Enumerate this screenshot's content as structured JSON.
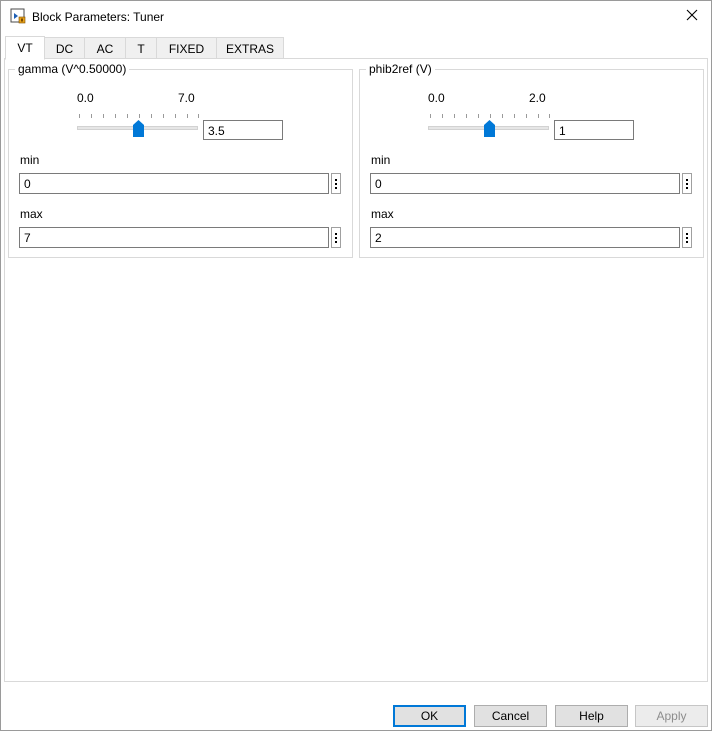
{
  "window": {
    "title": "Block Parameters: Tuner"
  },
  "tabs": [
    {
      "label": "VT",
      "active": true
    },
    {
      "label": "DC",
      "active": false
    },
    {
      "label": "AC",
      "active": false
    },
    {
      "label": "T",
      "active": false
    },
    {
      "label": "FIXED",
      "active": false
    },
    {
      "label": "EXTRAS",
      "active": false
    }
  ],
  "panels": [
    {
      "title": "gamma (V^0.50000)",
      "slider": {
        "min_label": "0.0",
        "max_label": "7.0",
        "value": "3.5",
        "position_fraction": 0.5
      },
      "min": {
        "label": "min",
        "value": "0"
      },
      "max": {
        "label": "max",
        "value": "7"
      }
    },
    {
      "title": "phib2ref (V)",
      "slider": {
        "min_label": "0.0",
        "max_label": "2.0",
        "value": "1",
        "position_fraction": 0.5
      },
      "min": {
        "label": "min",
        "value": "0"
      },
      "max": {
        "label": "max",
        "value": "2"
      }
    }
  ],
  "buttons": {
    "ok": "OK",
    "cancel": "Cancel",
    "help": "Help",
    "apply": "Apply"
  },
  "colors": {
    "accent": "#0078d7"
  }
}
